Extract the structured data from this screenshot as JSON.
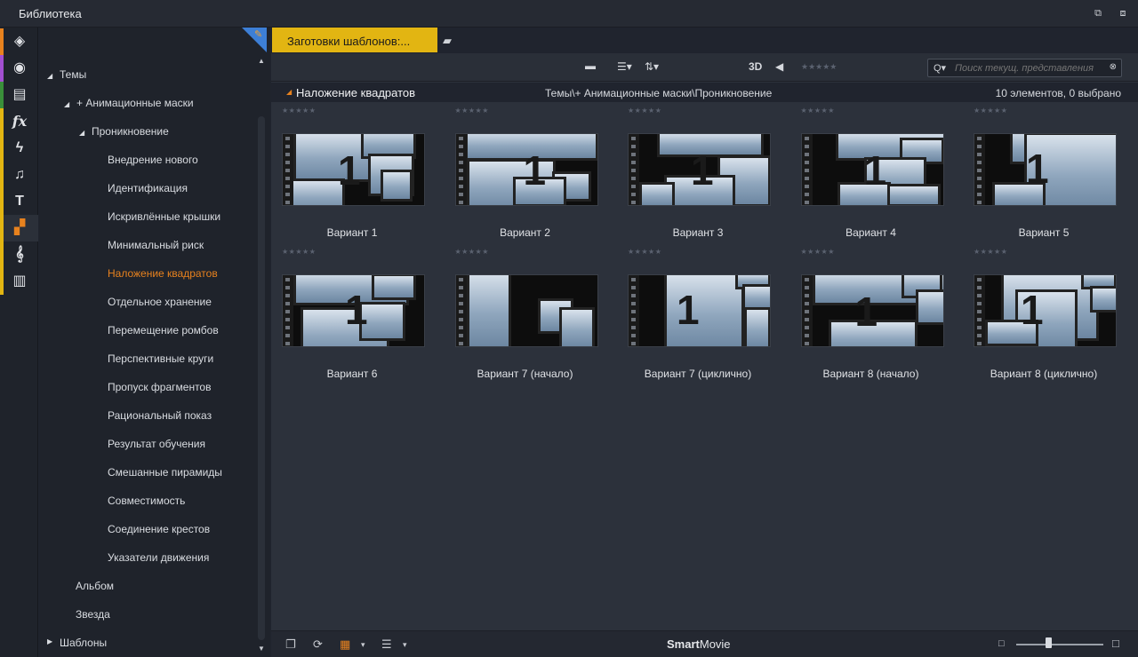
{
  "window": {
    "title": "Библиотека"
  },
  "iconbar": {
    "items": [
      {
        "name": "packages-icon",
        "glyph": "◈",
        "stripe": "#e8821e"
      },
      {
        "name": "film-reel-icon",
        "glyph": "◉",
        "stripe": "#a24fd0"
      },
      {
        "name": "photos-icon",
        "glyph": "▤",
        "stripe": "#3a8f3a"
      },
      {
        "name": "fx-icon",
        "glyph": "fx",
        "stripe": "#e2b512"
      },
      {
        "name": "lightning-icon",
        "glyph": "ϟ",
        "stripe": "#e2b512"
      },
      {
        "name": "music-note-icon",
        "glyph": "♫",
        "stripe": "#e2b512"
      },
      {
        "name": "text-icon",
        "glyph": "T",
        "stripe": "#e2b512"
      },
      {
        "name": "montage-icon",
        "glyph": "▞",
        "stripe": "#e2b512"
      },
      {
        "name": "treble-clef-icon",
        "glyph": "𝄞",
        "stripe": "#e2b512"
      },
      {
        "name": "piano-icon",
        "glyph": "▥",
        "stripe": "#e2b512"
      }
    ]
  },
  "tree": {
    "themes": "Темы",
    "anim_masks": "+ Анимационные маски",
    "penetration": "Проникновение",
    "leaves": [
      "Внедрение нового",
      "Идентификация",
      "Искривлённые крышки",
      "Минимальный риск",
      "Наложение квадратов",
      "Отдельное хранение",
      "Перемещение ромбов",
      "Перспективные круги",
      "Пропуск фрагментов",
      "Рациональный показ",
      "Результат обучения",
      "Смешанные пирамиды",
      "Совместимость",
      "Соединение крестов",
      "Указатели движения"
    ],
    "album": "Альбом",
    "star": "Звезда",
    "templates": "Шаблоны"
  },
  "tabs": {
    "active": "Заготовки шаблонов:..."
  },
  "toolbar": {
    "three_d": "3D",
    "search_placeholder": "Поиск текущ. представления",
    "stars": "★★★★★"
  },
  "pathbar": {
    "group": "Наложение квадратов",
    "path": "Темы\\+ Анимационные маски\\Проникновение",
    "count": "10 элементов, 0 выбрано"
  },
  "items": [
    {
      "label": "Вариант 1",
      "rating": 0
    },
    {
      "label": "Вариант 2",
      "rating": 0
    },
    {
      "label": "Вариант 3",
      "rating": 0
    },
    {
      "label": "Вариант 4",
      "rating": 0
    },
    {
      "label": "Вариант 5",
      "rating": 0
    },
    {
      "label": "Вариант 6",
      "rating": 0
    },
    {
      "label": "Вариант 7 (начало)",
      "rating": 0
    },
    {
      "label": "Вариант 7 (циклично)",
      "rating": 0
    },
    {
      "label": "Вариант 8 (начало)",
      "rating": 0
    },
    {
      "label": "Вариант 8 (циклично)",
      "rating": 0
    }
  ],
  "thumb_text": "1",
  "bottombar": {
    "brand_bold": "Smart",
    "brand_rest": "Movie",
    "zoom_level": 0.37
  },
  "colors": {
    "accent": "#e8821e",
    "tab": "#e2b512",
    "selection": "#3d7fd6"
  }
}
